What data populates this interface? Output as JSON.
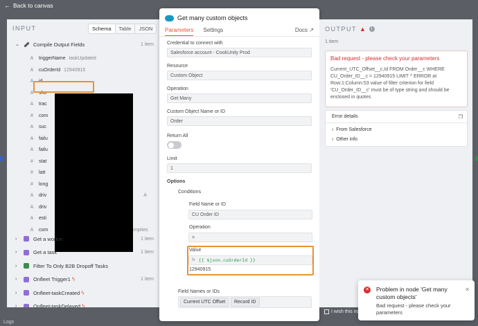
{
  "topbar": {
    "back_label": "Back to canvas"
  },
  "input": {
    "title": "INPUT",
    "tabs": [
      "Schema",
      "Table",
      "JSON"
    ],
    "active_tab": "Schema",
    "compile_node": {
      "name": "Compile Output Fields",
      "items": "1 item"
    },
    "fields": [
      {
        "type": "A",
        "name": "triggerName",
        "value": "taskUpdated"
      },
      {
        "type": "A",
        "name": "cuOrderId",
        "value": "12940915"
      },
      {
        "type": "A",
        "name": "id",
        "value": ""
      },
      {
        "type": "A",
        "name": "sho",
        "value": ""
      },
      {
        "type": "A",
        "name": "trac",
        "value": ""
      },
      {
        "type": "#",
        "name": "com",
        "value": ""
      },
      {
        "type": "A",
        "name": "suc",
        "value": ""
      },
      {
        "type": "A",
        "name": "failu",
        "value": ""
      },
      {
        "type": "A",
        "name": "failu",
        "value": ""
      },
      {
        "type": "#",
        "name": "stat",
        "value": ""
      },
      {
        "type": "#",
        "name": "latt",
        "value": ""
      },
      {
        "type": "#",
        "name": "long",
        "value": ""
      },
      {
        "type": "A",
        "name": "driv",
        "value": "A"
      },
      {
        "type": "A",
        "name": "driv",
        "value": ""
      },
      {
        "type": "A",
        "name": "esti",
        "value": ""
      },
      {
        "type": "A",
        "name": "com",
        "value": "no empties"
      }
    ],
    "other_nodes": [
      {
        "name": "Get a worker",
        "items": "1 item",
        "color": "#8f6ed5",
        "flash": false
      },
      {
        "name": "Get a task",
        "items": "1 item",
        "color": "#8f6ed5",
        "flash": false
      },
      {
        "name": "Filter To Only B2B Dropoff Tasks",
        "items": "",
        "color": "#3a8d4a",
        "flash": false
      },
      {
        "name": "Onfleet Trigger1",
        "items": "1 item",
        "color": "#8f6ed5",
        "flash": true
      },
      {
        "name": "Onfleet-taskCreated",
        "items": "",
        "color": "#8f6ed5",
        "flash": true
      },
      {
        "name": "Onfleet-taskDelayed",
        "items": "",
        "color": "#8f6ed5",
        "flash": true
      }
    ]
  },
  "node": {
    "title": "Get many custom objects",
    "tab_parameters": "Parameters",
    "tab_settings": "Settings",
    "docs": "Docs",
    "credential_label": "Credential to connect with",
    "credential_value": "Salesforce account - CookUnity Prod",
    "resource_label": "Resource",
    "resource_value": "Custom Object",
    "operation_label": "Operation",
    "operation_value": "Get Many",
    "object_label": "Custom Object Name or ID",
    "object_value": "Order",
    "return_all_label": "Return All",
    "limit_label": "Limit",
    "limit_value": "1",
    "options_label": "Options",
    "conditions_label": "Conditions",
    "field_name_label": "Field Name or ID",
    "field_name_value": "CU Order ID",
    "cond_operation_label": "Operation",
    "cond_operation_value": "=",
    "value_label": "Value",
    "value_fx": "fx",
    "value_expr": "{{ $json.cuOrderId }}",
    "value_result": "12940915",
    "field_names_label": "Field Names or IDs",
    "field_chips": [
      "Current UTC Offset",
      "Record ID"
    ]
  },
  "output": {
    "title": "OUTPUT",
    "items": "1 item",
    "error_title": "Bad request - please check your parameters",
    "error_message": "Current_UTC_Offset__c,Id FROM Order__c WHERE CU_Order_ID__c = 12940915 LIMIT ^ ERROR at Row:1:Column:53 value of filter criterion for field 'CU_Order_ID__c' must be of type string and should be enclosed in quotes",
    "details_title": "Error details",
    "details_items": [
      "From Salesforce",
      "Other info"
    ]
  },
  "toast": {
    "title": "Problem in node 'Get many custom objects'",
    "message": "Bad request - please check your parameters"
  },
  "footer": {
    "wish": "I wish this node",
    "logs": "Logs"
  }
}
